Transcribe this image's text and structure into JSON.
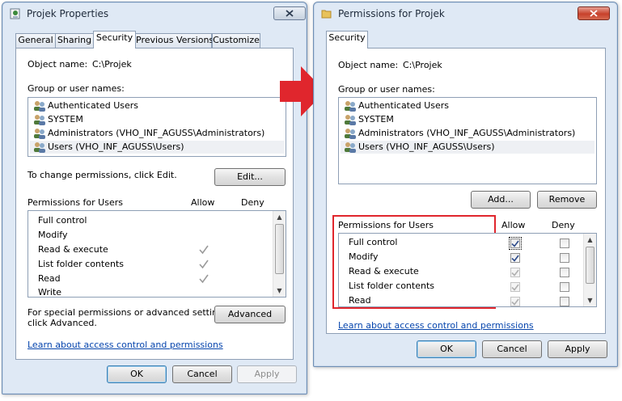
{
  "colors": {
    "accent_red": "#e0262d",
    "link": "#0645ad",
    "selection": "#eef0f4"
  },
  "left": {
    "title": "Projek Properties",
    "tabs": [
      "General",
      "Sharing",
      "Security",
      "Previous Versions",
      "Customize"
    ],
    "active_tab": "Security",
    "object_name_label": "Object name:",
    "object_name_value": "C:\\Projek",
    "group_label": "Group or user names:",
    "users": [
      "Authenticated Users",
      "SYSTEM",
      "Administrators (VHO_INF_AGUSS\\Administrators)",
      "Users (VHO_INF_AGUSS\\Users)"
    ],
    "change_hint": "To change permissions, click Edit.",
    "edit_button": "Edit...",
    "perm_header": "Permissions for Users",
    "allow_header": "Allow",
    "deny_header": "Deny",
    "permissions": [
      {
        "name": "Full control",
        "allow": false
      },
      {
        "name": "Modify",
        "allow": false
      },
      {
        "name": "Read & execute",
        "allow": true
      },
      {
        "name": "List folder contents",
        "allow": true
      },
      {
        "name": "Read",
        "allow": true
      },
      {
        "name": "Write",
        "allow": false
      }
    ],
    "special_text_1": "For special permissions or advanced settings,",
    "special_text_2": "click Advanced.",
    "advanced_button": "Advanced",
    "learn_link": "Learn about access control and permissions",
    "ok": "OK",
    "cancel": "Cancel",
    "apply": "Apply"
  },
  "right": {
    "title": "Permissions for Projek",
    "tab": "Security",
    "object_name_label": "Object name:",
    "object_name_value": "C:\\Projek",
    "group_label": "Group or user names:",
    "users": [
      "Authenticated Users",
      "SYSTEM",
      "Administrators (VHO_INF_AGUSS\\Administrators)",
      "Users (VHO_INF_AGUSS\\Users)"
    ],
    "add_button": "Add...",
    "remove_button": "Remove",
    "perm_header": "Permissions for Users",
    "allow_header": "Allow",
    "deny_header": "Deny",
    "permissions": [
      {
        "name": "Full control",
        "allow": true,
        "allow_disabled": false,
        "deny": false
      },
      {
        "name": "Modify",
        "allow": true,
        "allow_disabled": false,
        "deny": false
      },
      {
        "name": "Read & execute",
        "allow": true,
        "allow_disabled": true,
        "deny": false
      },
      {
        "name": "List folder contents",
        "allow": true,
        "allow_disabled": true,
        "deny": false
      },
      {
        "name": "Read",
        "allow": true,
        "allow_disabled": true,
        "deny": false
      }
    ],
    "learn_link": "Learn about access control and permissions",
    "ok": "OK",
    "cancel": "Cancel",
    "apply": "Apply"
  }
}
